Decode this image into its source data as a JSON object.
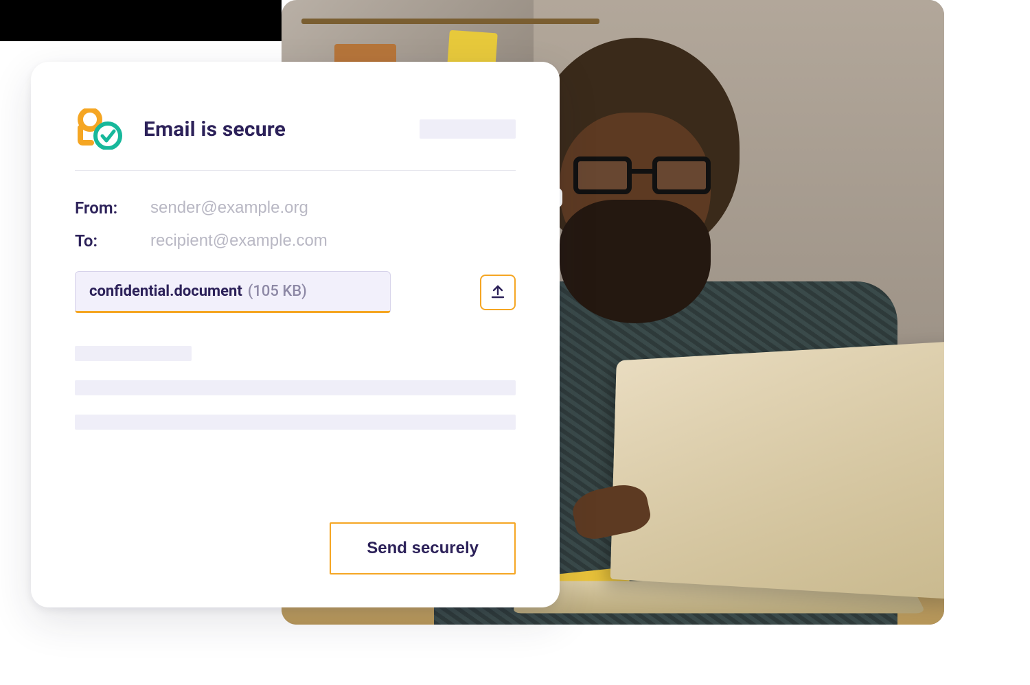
{
  "header": {
    "title": "Email is secure"
  },
  "fields": {
    "from_label": "From:",
    "from_value": "sender@example.org",
    "to_label": "To:",
    "to_value": "recipient@example.com"
  },
  "attachment": {
    "filename": "confidential.document",
    "size": "(105 KB)"
  },
  "actions": {
    "send_label": "Send securely"
  },
  "icons": {
    "upload": "upload-icon",
    "secure_badge": "shield-check-icon"
  },
  "colors": {
    "accent_orange": "#f5a623",
    "accent_teal": "#17b89b",
    "text_primary": "#2c2159",
    "text_muted": "#b9b8c4",
    "chip_bg": "#f2f0fb"
  }
}
